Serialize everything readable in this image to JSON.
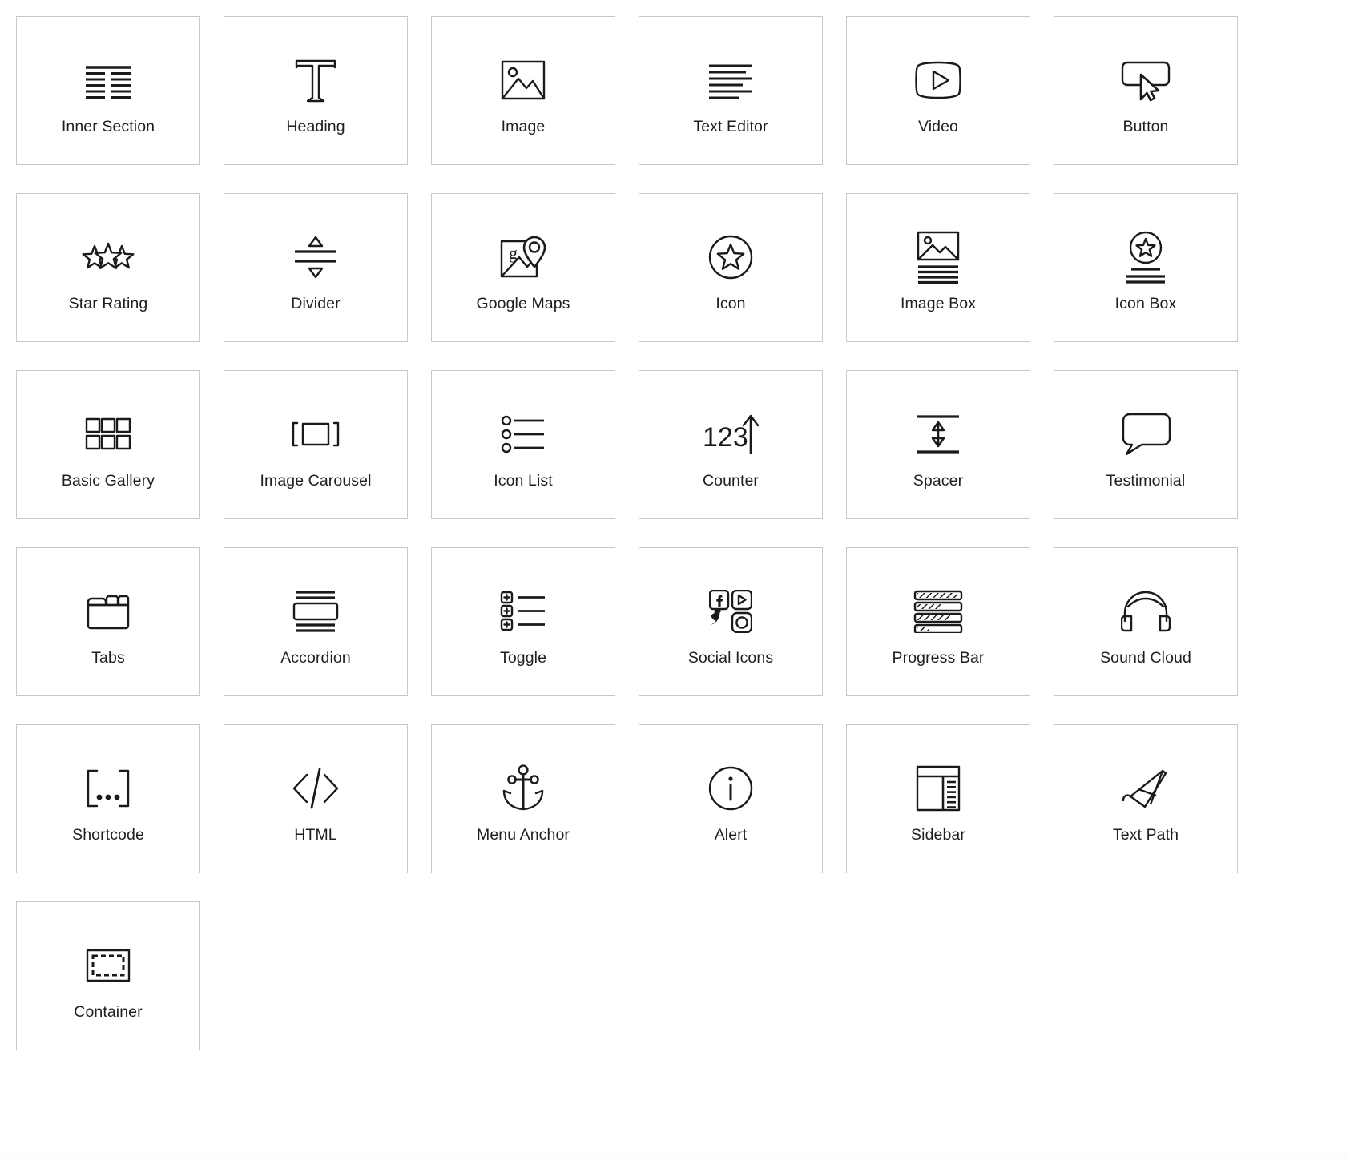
{
  "panel": {
    "title": "Elementor Widgets Panel",
    "columns": 6,
    "card_count": 31,
    "border_color": "#c8c8c8",
    "label_color": "#1f1f1f",
    "background_color": "#ffffff"
  },
  "widgets": [
    {
      "label": "Inner Section",
      "icon": "inner-section-icon"
    },
    {
      "label": "Heading",
      "icon": "heading-t-icon"
    },
    {
      "label": "Image",
      "icon": "image-icon"
    },
    {
      "label": "Text Editor",
      "icon": "text-editor-icon"
    },
    {
      "label": "Video",
      "icon": "video-play-icon"
    },
    {
      "label": "Button",
      "icon": "button-cursor-icon"
    },
    {
      "label": "Star Rating",
      "icon": "star-rating-icon"
    },
    {
      "label": "Divider",
      "icon": "divider-icon"
    },
    {
      "label": "Google Maps",
      "icon": "google-maps-pin-icon"
    },
    {
      "label": "Icon",
      "icon": "star-circle-icon"
    },
    {
      "label": "Image Box",
      "icon": "image-box-icon"
    },
    {
      "label": "Icon Box",
      "icon": "icon-box-icon"
    },
    {
      "label": "Basic Gallery",
      "icon": "gallery-grid-icon"
    },
    {
      "label": "Image Carousel",
      "icon": "image-carousel-icon"
    },
    {
      "label": "Icon List",
      "icon": "icon-list-icon"
    },
    {
      "label": "Counter",
      "icon": "counter-123-arrow-icon"
    },
    {
      "label": "Spacer",
      "icon": "spacer-arrows-icon"
    },
    {
      "label": "Testimonial",
      "icon": "speech-bubble-icon"
    },
    {
      "label": "Tabs",
      "icon": "tabs-folder-icon"
    },
    {
      "label": "Accordion",
      "icon": "accordion-icon"
    },
    {
      "label": "Toggle",
      "icon": "toggle-plus-list-icon"
    },
    {
      "label": "Social Icons",
      "icon": "social-icons-grid-icon"
    },
    {
      "label": "Progress Bar",
      "icon": "progress-bar-icon"
    },
    {
      "label": "Sound Cloud",
      "icon": "headphones-icon"
    },
    {
      "label": "Shortcode",
      "icon": "shortcode-brackets-icon"
    },
    {
      "label": "HTML",
      "icon": "code-slash-icon"
    },
    {
      "label": "Menu Anchor",
      "icon": "anchor-icon"
    },
    {
      "label": "Alert",
      "icon": "info-circle-icon"
    },
    {
      "label": "Sidebar",
      "icon": "sidebar-layout-icon"
    },
    {
      "label": "Text Path",
      "icon": "text-path-pen-icon"
    },
    {
      "label": "Container",
      "icon": "container-dashed-icon"
    }
  ]
}
